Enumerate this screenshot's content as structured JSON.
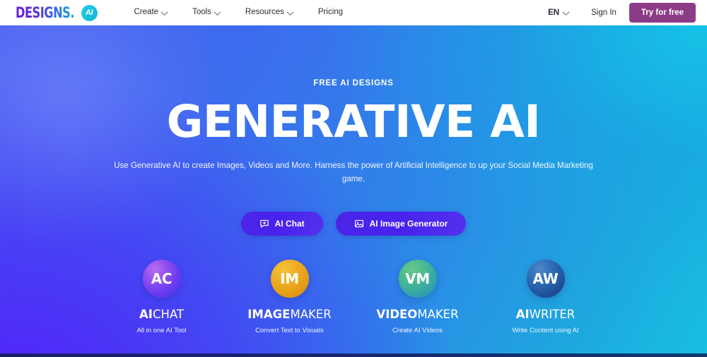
{
  "header": {
    "logo": {
      "text": "DESIGNS.",
      "badge": "AI",
      "name": "designs-ai-logo"
    },
    "nav": [
      {
        "label": "Create",
        "has_chevron": true
      },
      {
        "label": "Tools",
        "has_chevron": true
      },
      {
        "label": "Resources",
        "has_chevron": true
      },
      {
        "label": "Pricing",
        "has_chevron": false
      }
    ],
    "language": {
      "label": "EN",
      "has_chevron": true
    },
    "sign_in_label": "Sign In",
    "try_free_label": "Try for free",
    "try_free_color": "#8c3c87"
  },
  "hero": {
    "eyebrow": "FREE AI DESIGNS",
    "headline": "GENERATIVE AI",
    "subtitle": "Use Generative AI to create Images, Videos and More. Harness the power of Artificial Intelligence to up your Social Media Marketing game.",
    "background_colors": {
      "top_left": "#4b63f0",
      "top_right": "#16bfe2",
      "bottom_left": "#4a2ef8",
      "bottom_right": "#1f8ee0",
      "bottom_strip": "#1b1f6e"
    },
    "cta_buttons": [
      {
        "label": "AI Chat",
        "icon": "chat-plus-icon"
      },
      {
        "label": "AI Image Generator",
        "icon": "image-picture-icon"
      }
    ]
  },
  "features": [
    {
      "initials": "AC",
      "title_bold": "AI",
      "title_rest": "CHAT",
      "subtitle": "All in one AI Tool",
      "color": "#8a4bf0",
      "key": "ai-chat"
    },
    {
      "initials": "IM",
      "title_bold": "IMAGE",
      "title_rest": "MAKER",
      "subtitle": "Convert Text to Visuals",
      "color": "#eaa61c",
      "key": "image-maker"
    },
    {
      "initials": "VM",
      "title_bold": "VIDEO",
      "title_rest": "MAKER",
      "subtitle": "Create AI Videos",
      "color": "#3aa79f",
      "key": "video-maker"
    },
    {
      "initials": "AW",
      "title_bold": "AI",
      "title_rest": "WRITER",
      "subtitle": "Write Content using AI",
      "color": "#2a61ab",
      "key": "ai-writer"
    }
  ]
}
